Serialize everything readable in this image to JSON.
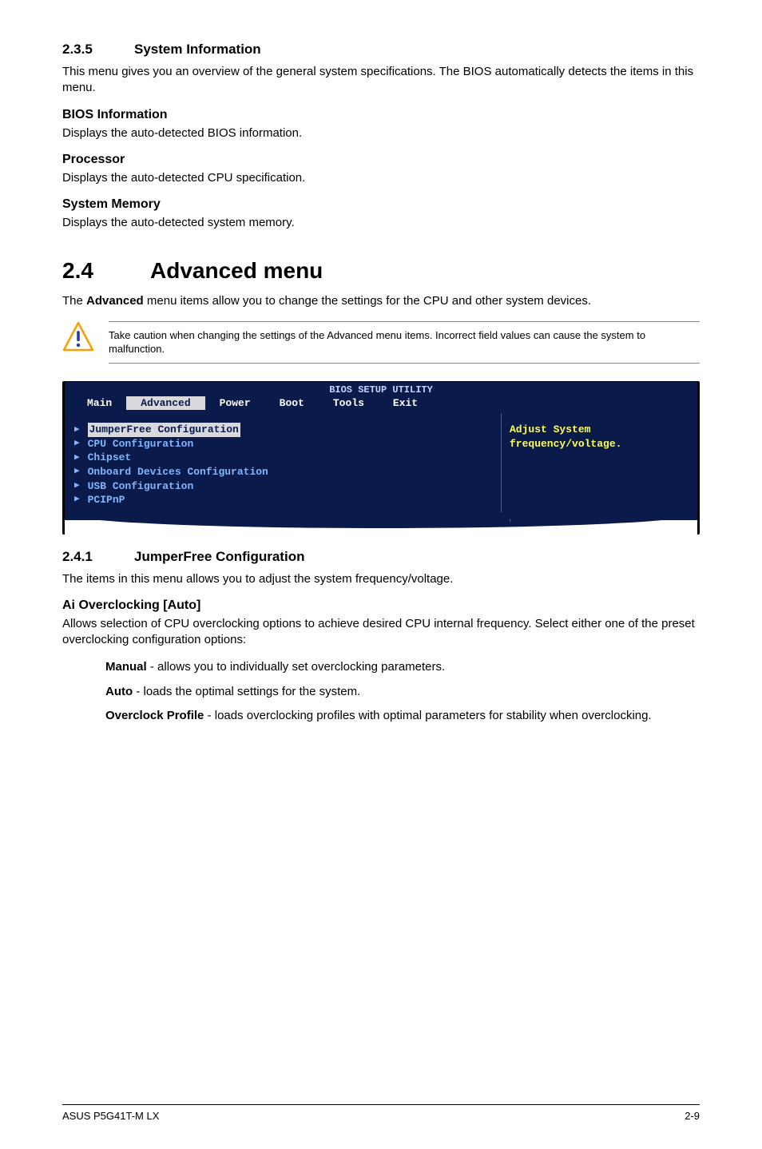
{
  "section235": {
    "num": "2.3.5",
    "title": "System Information",
    "intro": "This menu gives you an overview of the general system specifications. The BIOS automatically detects the items in this menu.",
    "sub1_title": "BIOS Information",
    "sub1_body": "Displays the auto-detected BIOS information.",
    "sub2_title": "Processor",
    "sub2_body": "Displays the auto-detected CPU specification.",
    "sub3_title": "System Memory",
    "sub3_body": "Displays the auto-detected system memory."
  },
  "section24": {
    "num": "2.4",
    "title": "Advanced menu",
    "intro_prefix": "The ",
    "intro_bold": "Advanced",
    "intro_suffix": " menu items allow you to change the settings for the CPU and other system devices.",
    "caution": "Take caution when changing the settings of the Advanced menu items. Incorrect field values can cause the system to malfunction."
  },
  "bios": {
    "title": "BIOS SETUP UTILITY",
    "tabs": [
      "Main",
      "Advanced",
      "Power",
      "Boot",
      "Tools",
      "Exit"
    ],
    "selected_tab_index": 1,
    "menu_items": [
      "JumperFree Configuration",
      "CPU Configuration",
      "Chipset",
      "Onboard Devices Configuration",
      "USB Configuration",
      "PCIPnP"
    ],
    "selected_item_index": 0,
    "help_line1": "Adjust System",
    "help_line2": "frequency/voltage."
  },
  "section241": {
    "num": "2.4.1",
    "title": "JumperFree Configuration",
    "intro": "The items in this menu allows you to adjust the system frequency/voltage.",
    "sub_title": "Ai Overclocking [Auto]",
    "sub_body": "Allows selection of CPU overclocking options to achieve desired CPU internal frequency. Select either one of the preset overclocking configuration options:",
    "opt1_bold": "Manual",
    "opt1_rest": " - allows you to individually set overclocking parameters.",
    "opt2_bold": "Auto",
    "opt2_rest": " - loads the optimal settings for the system.",
    "opt3_bold": "Overclock Profile",
    "opt3_rest": " - loads overclocking profiles with optimal parameters for stability when overclocking."
  },
  "footer": {
    "left": "ASUS P5G41T-M LX",
    "right": "2-9"
  }
}
